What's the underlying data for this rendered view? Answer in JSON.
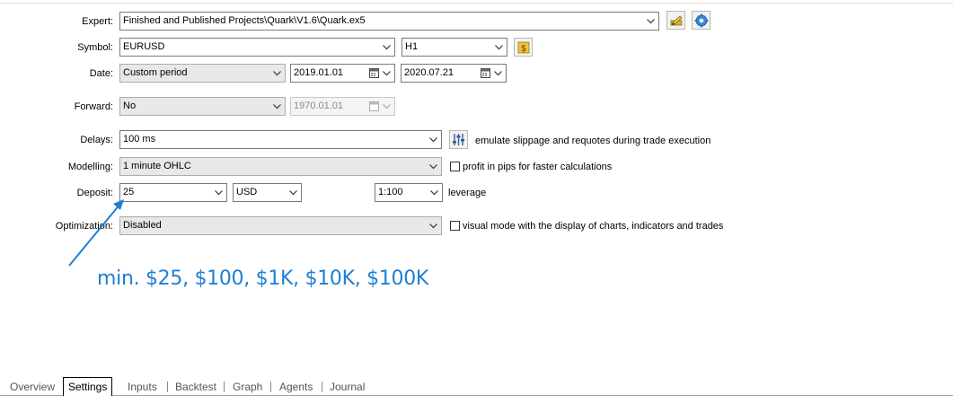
{
  "form": {
    "expert": {
      "label": "Expert:",
      "value": "Finished and Published Projects\\Quark\\V1.6\\Quark.ex5"
    },
    "symbol": {
      "label": "Symbol:",
      "value": "EURUSD",
      "timeframe": "H1"
    },
    "date": {
      "label": "Date:",
      "mode": "Custom period",
      "from": "2019.01.01",
      "to": "2020.07.21"
    },
    "forward": {
      "label": "Forward:",
      "value": "No",
      "date": "1970.01.01"
    },
    "delays": {
      "label": "Delays:",
      "value": "100 ms",
      "note": "emulate slippage and requotes during trade execution"
    },
    "modelling": {
      "label": "Modelling:",
      "value": "1 minute OHLC",
      "checkbox_label": "profit in pips for faster calculations",
      "checked": false
    },
    "deposit": {
      "label": "Deposit:",
      "value": "25",
      "currency": "USD",
      "leverage": "1:100",
      "leverage_label": "leverage"
    },
    "optimization": {
      "label": "Optimization:",
      "value": "Disabled",
      "checkbox_label": "visual mode with the display of charts, indicators and trades",
      "checked": false
    }
  },
  "annotation": {
    "text": "min. $25, $100, $1K, $10K, $100K",
    "color": "#1e7fd6"
  },
  "tabs": [
    "Overview",
    "Settings",
    "Inputs",
    "Backtest",
    "Graph",
    "Agents",
    "Journal"
  ],
  "active_tab": "Settings",
  "icons": {
    "expert_edit": "edit-pencil-icon",
    "expert_settings": "gear-icon",
    "symbol_specs": "dollar-icon",
    "delays_settings": "sliders-icon",
    "dropdown": "chevron-down-icon",
    "calendar": "calendar-icon"
  }
}
